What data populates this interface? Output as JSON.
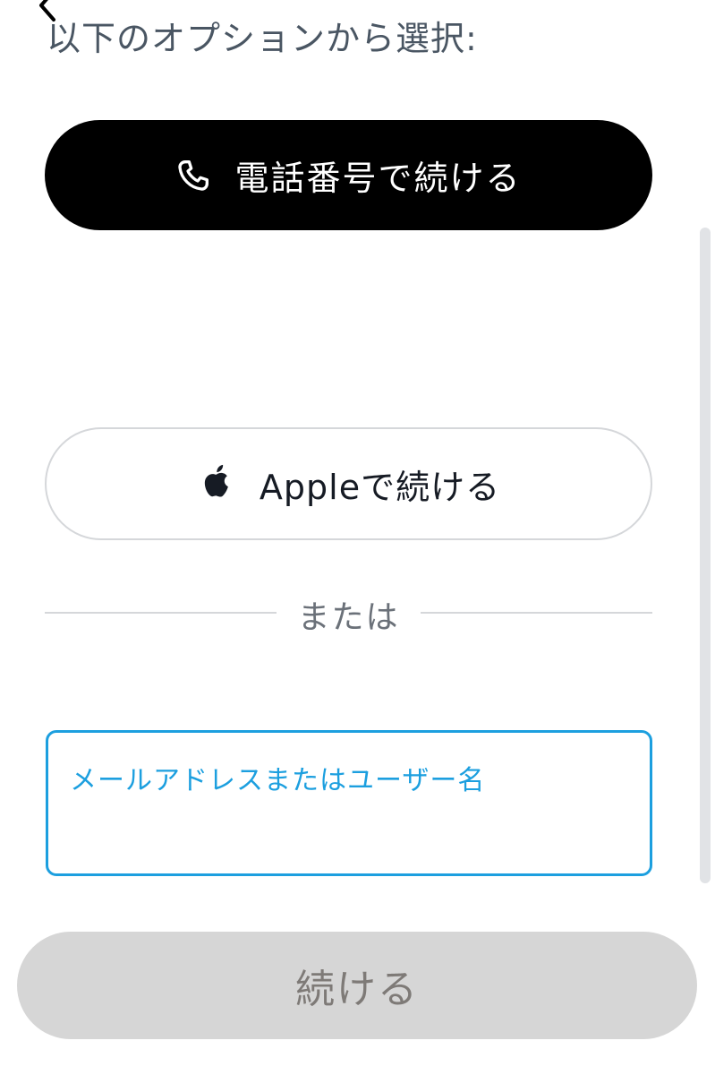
{
  "header": {
    "back_icon": "chevron-left-icon",
    "title": "以下のオプションから選択:"
  },
  "options": {
    "phone": {
      "label": "電話番号で続ける",
      "icon": "phone-icon"
    },
    "apple": {
      "label": "Appleで続ける",
      "icon": "apple-logo-icon"
    }
  },
  "divider": {
    "text": "または"
  },
  "identifier_field": {
    "label": "メールアドレスまたはユーザー名",
    "value": "",
    "focused": true
  },
  "continue_button": {
    "label": "続ける",
    "enabled": false
  },
  "colors": {
    "primary_button": "#000000",
    "focus_accent": "#1c9fdf",
    "disabled_button": "#d6d6d6",
    "disabled_text": "#7e7a77",
    "heading_text": "#4a5663",
    "border_gray": "#d5d7da"
  }
}
